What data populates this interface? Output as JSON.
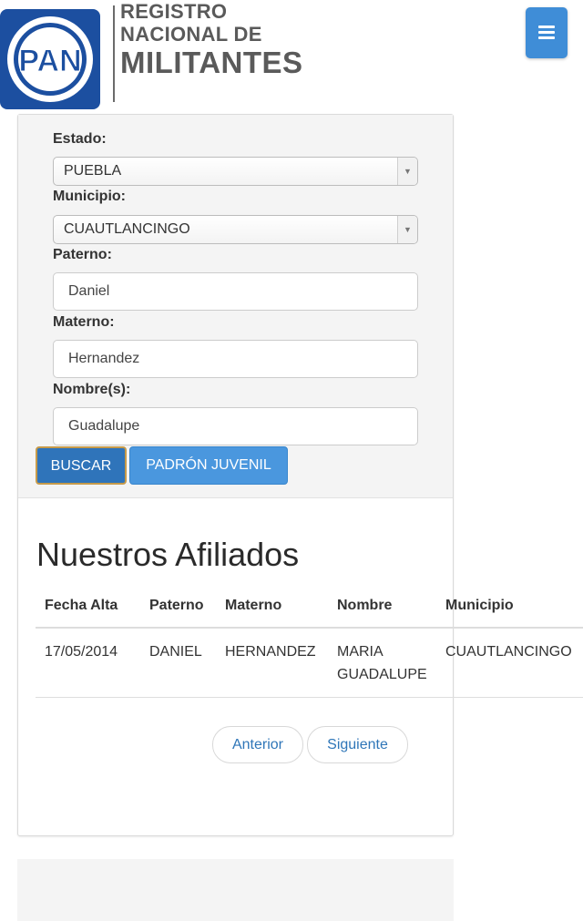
{
  "header": {
    "logo_text": "PAN",
    "brand_line1": "REGISTRO",
    "brand_line2": "NACIONAL DE",
    "brand_line3": "MILITANTES",
    "menu_icon": "hamburger-menu-icon"
  },
  "form": {
    "estado_label": "Estado:",
    "estado_value": "PUEBLA",
    "municipio_label": "Municipio:",
    "municipio_value": "CUAUTLANCINGO",
    "paterno_label": "Paterno:",
    "paterno_value": "Daniel",
    "materno_label": "Materno:",
    "materno_value": "Hernandez",
    "nombre_label": "Nombre(s):",
    "nombre_value": "Guadalupe",
    "buscar_label": "BUSCAR",
    "padron_label": "PADRÓN JUVENIL"
  },
  "results": {
    "title": "Nuestros Afiliados",
    "columns": [
      "Fecha Alta",
      "Paterno",
      "Materno",
      "Nombre",
      "Municipio"
    ],
    "rows": [
      [
        "17/05/2014",
        "DANIEL",
        "HERNANDEZ",
        "MARIA GUADALUPE",
        "CUAUTLANCINGO"
      ]
    ]
  },
  "pagination": {
    "prev_label": "Anterior",
    "next_label": "Siguiente"
  },
  "colors": {
    "brand_blue": "#1c4fa0",
    "button_blue": "#4a97de",
    "button_dark_blue": "#2f74ba",
    "link_blue": "#2f76b8"
  }
}
